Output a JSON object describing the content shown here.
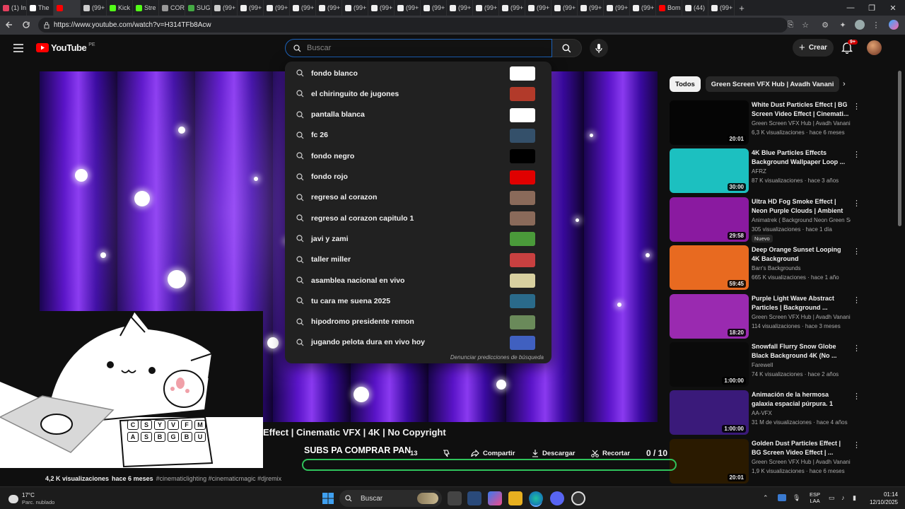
{
  "browser": {
    "tabs": [
      "(1) In",
      "The",
      "",
      "(99+",
      "Kick",
      "Stre",
      "COR",
      "SUG",
      "(99+",
      "(99+",
      "(99+",
      "(99+",
      "(99+",
      "(99+",
      "(99+",
      "(99+",
      "(99+",
      "(99+",
      "(99+",
      "(99+",
      "(99+",
      "(99+",
      "(99+",
      "(99+",
      "(99+",
      "Bom",
      "(44)",
      "(99+"
    ],
    "url": "https://www.youtube.com/watch?v=H314TFb8Acw",
    "minimize": "—",
    "maximize": "❐",
    "close": "✕"
  },
  "header": {
    "logo": "YouTube",
    "region": "PE",
    "search_placeholder": "Buscar",
    "create_label": "Crear",
    "notif_count": "9+"
  },
  "suggestions": [
    {
      "text": "fondo blanco",
      "thumb": "#ffffff"
    },
    {
      "text": "el chiringuito de jugones",
      "thumb": "#b23a2a"
    },
    {
      "text": "pantalla blanca",
      "thumb": "#ffffff"
    },
    {
      "text": "fc 26",
      "thumb": "#34506a"
    },
    {
      "text": "fondo negro",
      "thumb": "#000000"
    },
    {
      "text": "fondo rojo",
      "thumb": "#e00000"
    },
    {
      "text": "regreso al corazon",
      "thumb": "#8a6a5a"
    },
    {
      "text": "regreso al corazon capitulo 1",
      "thumb": "#8a6a5a"
    },
    {
      "text": "javi y zami",
      "thumb": "#4a9a3a"
    },
    {
      "text": "taller miller",
      "thumb": "#c84040"
    },
    {
      "text": "asamblea nacional en vivo",
      "thumb": "#d8d0a0"
    },
    {
      "text": "tu cara me suena 2025",
      "thumb": "#2a6a8a"
    },
    {
      "text": "hipodromo presidente remon",
      "thumb": "#6a8a5a"
    },
    {
      "text": "jugando pelota dura en vivo hoy",
      "thumb": "#4060c0"
    }
  ],
  "report_text": "Denunciar predicciones de búsqueda",
  "chips": [
    "Todos",
    "Green Screen VFX Hub | Avadh Vanani"
  ],
  "related": [
    {
      "title": "White Dust Particles Effect | BG Screen Video Effect | Cinemati...",
      "channel": "Green Screen VFX Hub | Avadh Vanani",
      "meta": "6,3 K visualizaciones · hace 6 meses",
      "duration": "20:01",
      "bg": "#050505",
      "badge": ""
    },
    {
      "title": "4K Blue Particles Effects Background Wallpaper Loop ...",
      "channel": "AFRZ",
      "meta": "87 K visualizaciones · hace 3 años",
      "duration": "30:00",
      "bg": "#1cc0c0",
      "badge": ""
    },
    {
      "title": "Ultra HD Fog Smoke Effect | Neon Purple Clouds | Ambient ...",
      "channel": "Animatrek ( Background Neon Green Scr...",
      "meta": "305 visualizaciones · hace 1 día",
      "duration": "29:58",
      "bg": "#8a1aa0",
      "badge": "Nuevo"
    },
    {
      "title": "Deep Orange Sunset Looping 4K Background",
      "channel": "Barr's Backgrounds",
      "meta": "665 K visualizaciones · hace 1 año",
      "duration": "59:45",
      "bg": "#e86a20",
      "badge": ""
    },
    {
      "title": "Purple Light Wave Abstract Particles | Background ...",
      "channel": "Green Screen VFX Hub | Avadh Vanani",
      "meta": "114 visualizaciones · hace 3 meses",
      "duration": "18:20",
      "bg": "#9a2ab0",
      "badge": ""
    },
    {
      "title": "Snowfall Flurry Snow Globe Black Background 4K (No ...",
      "channel": "Farewell",
      "meta": "74 K visualizaciones · hace 2 años",
      "duration": "1:00:00",
      "bg": "#0a0a0a",
      "badge": ""
    },
    {
      "title": "Animación de la hermosa galaxia espacial púrpura. 1 hor...",
      "channel": "AA-VFX",
      "meta": "31 M de visualizaciones · hace 4 años",
      "duration": "1:00:00",
      "bg": "#3a1a7a",
      "badge": ""
    },
    {
      "title": "Golden Dust Particles Effect | BG Screen Video Effect | ...",
      "channel": "Green Screen VFX Hub | Avadh Vanani",
      "meta": "1,9 K visualizaciones · hace 6 meses",
      "duration": "20:01",
      "bg": "#2a1a00",
      "badge": ""
    }
  ],
  "video": {
    "title_visible": "Effect | Cinematic VFX | 4K | No Copyright",
    "overlay_text": "SUBS PA COMPRAR PAN",
    "likes": "13",
    "share": "Compartir",
    "download": "Descargar",
    "clip": "Recortar",
    "counter": "0 / 10",
    "views": "4,2 K visualizaciones",
    "date": "hace 6 meses",
    "tags": "#cinematiclighting #cinematicmagic #djremix"
  },
  "cat": {
    "keys": [
      "C",
      "S",
      "Y",
      "V",
      "F",
      "M",
      "A",
      "S",
      "B",
      "G",
      "B",
      "U"
    ]
  },
  "taskbar": {
    "weather_temp": "17°C",
    "weather_desc": "Parc. nublado",
    "search": "Buscar",
    "lang1": "ESP",
    "lang2": "LAA",
    "time": "01:14",
    "date": "12/10/2025"
  }
}
